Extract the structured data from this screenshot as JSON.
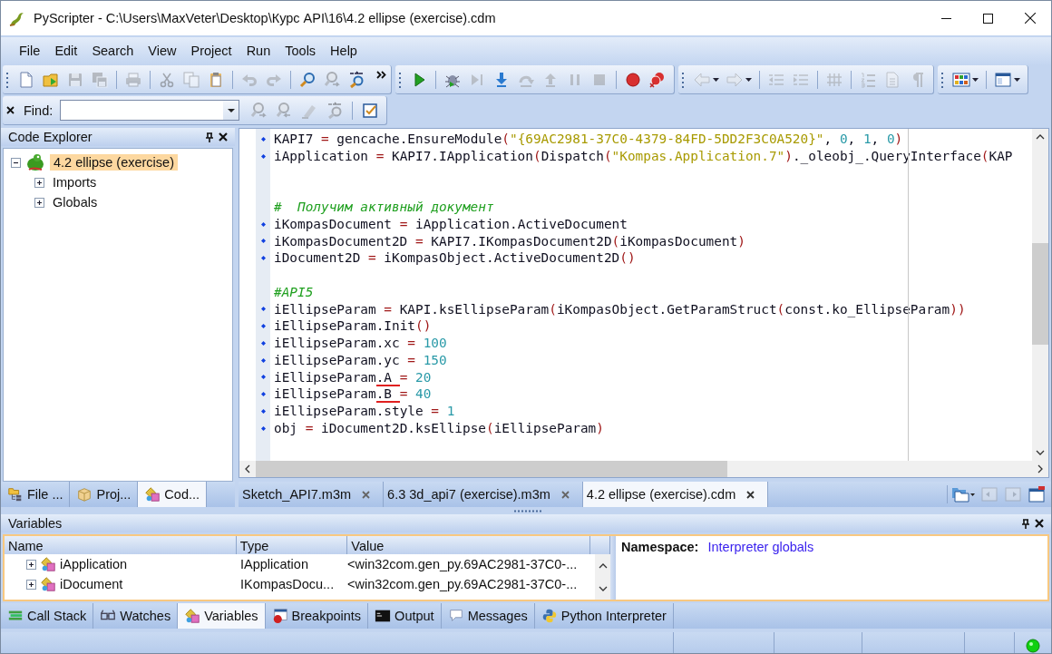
{
  "window": {
    "title": "PyScripter - C:\\Users\\MaxVeter\\Desktop\\Курс API\\16\\4.2 ellipse (exercise).cdm"
  },
  "menu": [
    "File",
    "Edit",
    "Search",
    "View",
    "Project",
    "Run",
    "Tools",
    "Help"
  ],
  "toolbars": [
    {
      "overflow": true,
      "groups": [
        [
          {
            "kind": "page",
            "disabled": false,
            "dropdown": false
          },
          {
            "kind": "folder",
            "disabled": false,
            "dropdown": false
          },
          {
            "kind": "floppy-disk",
            "disabled": true,
            "dropdown": false
          },
          {
            "kind": "floppies",
            "disabled": true,
            "dropdown": false
          }
        ],
        [
          {
            "kind": "printer",
            "disabled": true,
            "dropdown": false
          }
        ],
        [
          {
            "kind": "scissors",
            "disabled": true,
            "dropdown": false
          },
          {
            "kind": "copy",
            "disabled": true,
            "dropdown": false
          },
          {
            "kind": "clipboard",
            "disabled": false,
            "dropdown": false
          }
        ],
        [
          {
            "kind": "undo-arrow",
            "disabled": true,
            "dropdown": false
          },
          {
            "kind": "redo-arrow",
            "disabled": true,
            "dropdown": false
          }
        ],
        [
          {
            "kind": "search",
            "disabled": false,
            "dropdown": false
          },
          {
            "kind": "search-arrow",
            "disabled": true,
            "dropdown": false
          },
          {
            "kind": "replace",
            "disabled": false,
            "dropdown": false
          }
        ]
      ]
    },
    {
      "overflow": false,
      "groups": [
        [
          {
            "kind": "play",
            "disabled": false,
            "dropdown": false
          }
        ],
        [
          {
            "kind": "bug",
            "disabled": false,
            "dropdown": false
          },
          {
            "kind": "step-cursor",
            "disabled": true,
            "dropdown": false
          },
          {
            "kind": "down-arrow",
            "disabled": false,
            "dropdown": false
          },
          {
            "kind": "circular-arrow",
            "disabled": true,
            "dropdown": false
          },
          {
            "kind": "up-arrow",
            "disabled": true,
            "dropdown": false
          },
          {
            "kind": "pause",
            "disabled": true,
            "dropdown": false
          },
          {
            "kind": "stop",
            "disabled": true,
            "dropdown": false
          }
        ],
        [
          {
            "kind": "circle",
            "disabled": false,
            "dropdown": false
          },
          {
            "kind": "circles-cross",
            "disabled": false,
            "dropdown": false
          }
        ]
      ]
    },
    {
      "overflow": false,
      "groups": [
        [
          {
            "kind": "left-arrow",
            "disabled": true,
            "dropdown": true
          },
          {
            "kind": "right-arrow",
            "disabled": true,
            "dropdown": true
          }
        ],
        [
          {
            "kind": "outdent",
            "disabled": true,
            "dropdown": false
          },
          {
            "kind": "indent",
            "disabled": true,
            "dropdown": false
          }
        ],
        [
          {
            "kind": "hash",
            "disabled": true,
            "dropdown": false
          }
        ],
        [
          {
            "kind": "numbered-list",
            "disabled": true,
            "dropdown": false
          },
          {
            "kind": "document",
            "disabled": true,
            "dropdown": false
          },
          {
            "kind": "pilcrow",
            "disabled": true,
            "dropdown": false
          }
        ]
      ]
    },
    {
      "overflow": false,
      "groups": [
        [
          {
            "kind": "color-grid",
            "disabled": false,
            "dropdown": true
          }
        ],
        [
          {
            "kind": "window-layout",
            "disabled": false,
            "dropdown": true
          }
        ]
      ]
    }
  ],
  "find_bar": {
    "label": "Find:",
    "groups": [
      [
        {
          "kind": "search-arrow",
          "disabled": true,
          "dropdown": false
        },
        {
          "kind": "search-back",
          "disabled": true,
          "dropdown": false
        },
        {
          "kind": "marker",
          "disabled": true,
          "dropdown": false
        },
        {
          "kind": "replace",
          "disabled": true,
          "dropdown": false
        }
      ],
      [
        {
          "kind": "checklist",
          "disabled": false,
          "dropdown": false
        }
      ]
    ]
  },
  "code_explorer": {
    "title": "Code Explorer",
    "tree": [
      {
        "label": "4.2 ellipse (exercise)",
        "expanded": true,
        "selected": true,
        "children": [
          {
            "label": "Imports",
            "expanded": false,
            "selected": false
          },
          {
            "label": "Globals",
            "expanded": false,
            "selected": false
          }
        ]
      }
    ]
  },
  "left_tabs": [
    {
      "label": "File ...",
      "selected": false,
      "kind": "folder-tree"
    },
    {
      "label": "Proj...",
      "selected": false,
      "kind": "box"
    },
    {
      "label": "Cod...",
      "selected": true,
      "kind": "shapes"
    }
  ],
  "editor": {
    "lines": [
      {
        "kind": "code",
        "dot": true,
        "parts": [
          {
            "text": "KAPI7 = gencache.EnsureModule(\"{69AC2981-37C0-4379-84FD-5DD2F3C0A520}\", 0, 1, 0)",
            "underlined": false
          }
        ]
      },
      {
        "kind": "code",
        "dot": true,
        "parts": [
          {
            "text": "iApplication = KAPI7.IApplication(Dispatch(\"Kompas.Application.7\")._oleobj_.QueryInterface(KAP",
            "underlined": false
          }
        ]
      },
      {
        "kind": "blank"
      },
      {
        "kind": "blank"
      },
      {
        "kind": "code",
        "dot": false,
        "parts": [
          {
            "text": "#  Получим активный документ",
            "underlined": false
          }
        ]
      },
      {
        "kind": "code",
        "dot": true,
        "parts": [
          {
            "text": "iKompasDocument = iApplication.ActiveDocument",
            "underlined": false
          }
        ]
      },
      {
        "kind": "code",
        "dot": true,
        "parts": [
          {
            "text": "iKompasDocument2D = KAPI7.IKompasDocument2D(iKompasDocument)",
            "underlined": false
          }
        ]
      },
      {
        "kind": "code",
        "dot": true,
        "parts": [
          {
            "text": "iDocument2D = iKompasObject.ActiveDocument2D()",
            "underlined": false
          }
        ]
      },
      {
        "kind": "blank"
      },
      {
        "kind": "code",
        "dot": false,
        "parts": [
          {
            "text": "#API5",
            "underlined": false
          }
        ]
      },
      {
        "kind": "code",
        "dot": true,
        "parts": [
          {
            "text": "iEllipseParam = KAPI.ksEllipseParam(iKompasObject.GetParamStruct(const.ko_EllipseParam))",
            "underlined": false
          }
        ]
      },
      {
        "kind": "code",
        "dot": true,
        "parts": [
          {
            "text": "iEllipseParam.Init()",
            "underlined": false
          }
        ]
      },
      {
        "kind": "code",
        "dot": true,
        "parts": [
          {
            "text": "iEllipseParam.xc = 100",
            "underlined": false
          }
        ]
      },
      {
        "kind": "code",
        "dot": true,
        "parts": [
          {
            "text": "iEllipseParam.yc = 150",
            "underlined": false
          }
        ]
      },
      {
        "kind": "code",
        "dot": true,
        "parts": [
          {
            "text": "iEllipseParam",
            "underlined": false
          },
          {
            "text": ".A ",
            "underlined": true
          },
          {
            "text": "= 20",
            "underlined": false
          }
        ]
      },
      {
        "kind": "code",
        "dot": true,
        "parts": [
          {
            "text": "iEllipseParam",
            "underlined": false
          },
          {
            "text": ".B ",
            "underlined": true
          },
          {
            "text": "= 40",
            "underlined": false
          }
        ]
      },
      {
        "kind": "code",
        "dot": true,
        "parts": [
          {
            "text": "iEllipseParam.style = 1",
            "underlined": false
          }
        ]
      },
      {
        "kind": "code",
        "dot": true,
        "parts": [
          {
            "text": "obj = iDocument2D.ksEllipse(iEllipseParam)",
            "underlined": false
          }
        ]
      }
    ]
  },
  "editor_tabs": [
    {
      "label": "Sketch_API7.m3m",
      "selected": false
    },
    {
      "label": "6.3 3d_api7 (exercise).m3m",
      "selected": false
    },
    {
      "label": "4.2 ellipse (exercise).cdm",
      "selected": true
    }
  ],
  "variables": {
    "title": "Variables",
    "columns": [
      "Name",
      "Type",
      "Value"
    ],
    "rows": [
      {
        "name": "iApplication",
        "type": "IApplication",
        "value": "<win32com.gen_py.69AC2981-37C0-...",
        "expanded": false
      },
      {
        "name": "iDocument",
        "type": "IKompasDocu...",
        "value": "<win32com.gen_py.69AC2981-37C0-...",
        "expanded": false
      }
    ],
    "namespace_label": "Namespace:",
    "namespace_value": "Interpreter globals"
  },
  "bottom_tabs": [
    {
      "label": "Call Stack",
      "selected": false,
      "kind": "stack"
    },
    {
      "label": "Watches",
      "selected": false,
      "kind": "glasses"
    },
    {
      "label": "Variables",
      "selected": true,
      "kind": "shapes"
    },
    {
      "label": "Breakpoints",
      "selected": false,
      "kind": "breakpoint"
    },
    {
      "label": "Output",
      "selected": false,
      "kind": "console"
    },
    {
      "label": "Messages",
      "selected": false,
      "kind": "speech"
    },
    {
      "label": "Python Interpreter",
      "selected": false,
      "kind": "python"
    }
  ]
}
